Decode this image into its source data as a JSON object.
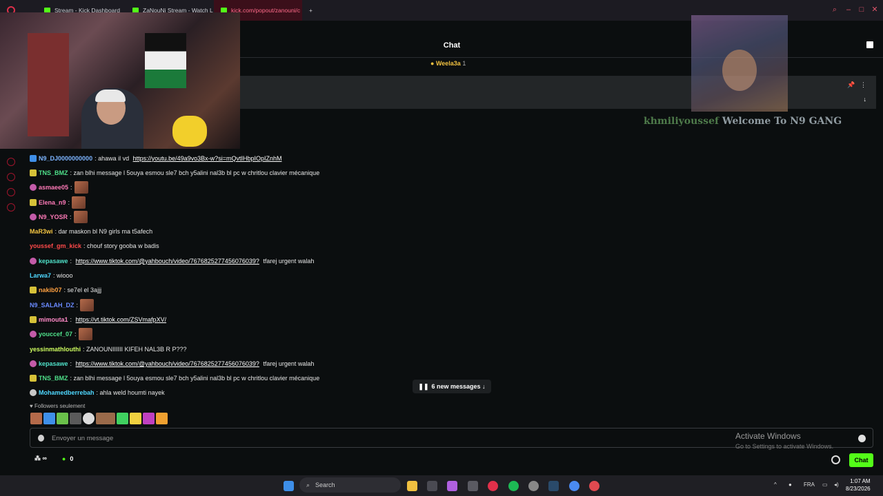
{
  "browser": {
    "tabs": [
      {
        "label": "Stream - Kick Dashboard",
        "active": false
      },
      {
        "label": "ZaNouNi Stream - Watch L",
        "active": false
      },
      {
        "label": "kick.com/popout/zanouni/c",
        "active": true
      }
    ],
    "new_tab_label": "+"
  },
  "chat": {
    "title": "Chat",
    "pinned_user": "Weela3a",
    "pinned_count": "1",
    "welcome_user": "khmiliyoussef",
    "welcome_text": "Welcome To N9 GANG",
    "new_messages_label": "6 new messages ↓",
    "followers_only": "Followers seulement",
    "input_placeholder": "Envoyer un message",
    "bottom_count": "0",
    "send_label": "Chat"
  },
  "messages": [
    {
      "user": "N9_DJ0000000000",
      "color": "#7cb4ff",
      "text": ": ahawa il vd ",
      "link": "https://youtu.be/49a9vo3Bx-w?si=mQvtIHbpIOpIZnhM",
      "after": "",
      "badge": "b-blue",
      "emote": false
    },
    {
      "user": "TNS_BMZ",
      "color": "#4fe08a",
      "text": ": zan blhi message l 5ouya esmou sle7 bch y5alini nal3b bl pc w chritlou clavier mécanique",
      "link": "",
      "after": "",
      "badge": "b-sub",
      "emote": false
    },
    {
      "user": "asmaee05",
      "color": "#ff7ab8",
      "text": ":",
      "link": "",
      "after": "",
      "badge": "b-pink",
      "emote": true
    },
    {
      "user": "Elena_n9",
      "color": "#ff7ab8",
      "text": ":",
      "link": "",
      "after": "",
      "badge": "b-sub",
      "emote": true
    },
    {
      "user": "N9_YOSR",
      "color": "#ff7ab8",
      "text": ":",
      "link": "",
      "after": "",
      "badge": "b-pink",
      "emote": true
    },
    {
      "user": "MaR3wi",
      "color": "#f4c542",
      "text": ": dar maskon bl N9 girls ma t5afech",
      "link": "",
      "after": "",
      "badge": "",
      "emote": false
    },
    {
      "user": "youssef_gm_kick",
      "color": "#ff4a4a",
      "text": ": chouf story gooba w badis",
      "link": "",
      "after": "",
      "badge": "",
      "emote": false
    },
    {
      "user": "kepasawe",
      "color": "#4fe0c8",
      "text": ": ",
      "link": "https://www.tiktok.com/@yahbouch/video/7676825277456076039?",
      "after": " tfarej urgent walah",
      "badge": "b-pink",
      "emote": false
    },
    {
      "user": "Larwa7",
      "color": "#4fd8ff",
      "text": ": wiooo",
      "link": "",
      "after": "",
      "badge": "",
      "emote": false
    },
    {
      "user": "nakib07",
      "color": "#ffa040",
      "text": ": se7el el 3ajjj",
      "link": "",
      "after": "",
      "badge": "b-sub",
      "emote": false
    },
    {
      "user": "N9_SALAH_DZ",
      "color": "#6a8aff",
      "text": ":",
      "link": "",
      "after": "",
      "badge": "",
      "emote": true
    },
    {
      "user": "mimouta1",
      "color": "#ff8ac8",
      "text": ": ",
      "link": "https://vt.tiktok.com/ZSVmafpXV/",
      "after": "",
      "badge": "b-sub",
      "emote": false
    },
    {
      "user": "youccef_07",
      "color": "#4fe08a",
      "text": ":",
      "link": "",
      "after": "",
      "badge": "b-pink",
      "emote": true
    },
    {
      "user": "yessinmathlouthi",
      "color": "#d0ff60",
      "text": ": ZANOUNIIIIII KIFEH NAL3B R P???",
      "link": "",
      "after": "",
      "badge": "",
      "emote": false
    },
    {
      "user": "kepasawe",
      "color": "#4fe0c8",
      "text": ": ",
      "link": "https://www.tiktok.com/@yahbouch/video/7676825277456076039?",
      "after": " tfarej urgent walah",
      "badge": "b-pink",
      "emote": false
    },
    {
      "user": "TNS_BMZ",
      "color": "#4fe08a",
      "text": ": zan blhi message l 5ouya esmou sle7 bch y5alini nal3b bl pc w chritlou clavier mécanique",
      "link": "",
      "after": "",
      "badge": "b-sub",
      "emote": false
    },
    {
      "user": "Mohamedberrebah",
      "color": "#4fd8ff",
      "text": ": ahla weld houmti nayek",
      "link": "",
      "after": "",
      "badge": "b-gray",
      "emote": false
    }
  ],
  "overlay": {
    "activate_title": "Activate Windows",
    "activate_sub": "Go to Settings to activate Windows."
  },
  "taskbar": {
    "search_label": "Search",
    "lang": "FRA",
    "time": "1:07 AM",
    "date": "8/23/2026"
  },
  "colors": {
    "accent": "#53fc18",
    "background": "#0b0e0f"
  }
}
